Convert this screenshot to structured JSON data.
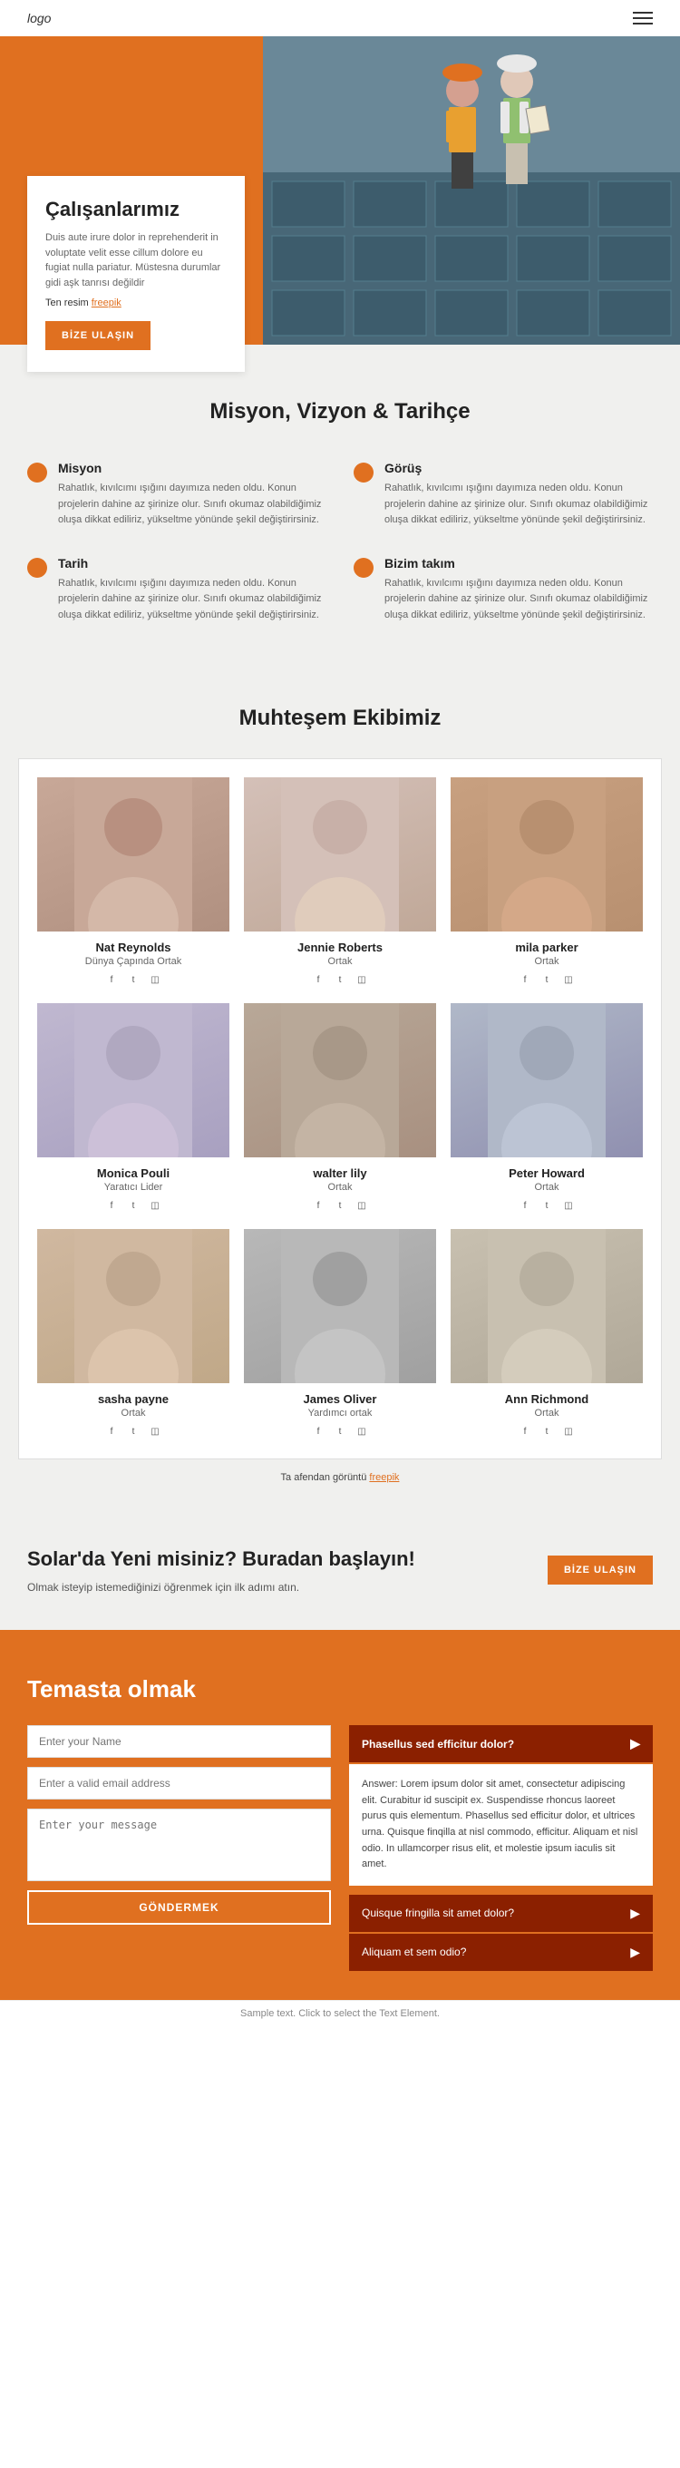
{
  "nav": {
    "logo": "logo",
    "menu_icon": "hamburger-menu"
  },
  "hero": {
    "title": "Çalışanlarımız",
    "description": "Duis aute irure dolor in reprehenderit in voluptate velit esse cillum dolore eu fugiat nulla pariatur. Müstesna durumlar gidi aşk tanrısı değildir",
    "link_prefix": "Ten resim",
    "link_text": "freepik",
    "cta_button": "BİZE ULAŞIN"
  },
  "mission": {
    "section_title": "Misyon, Vizyon & Tarihçe",
    "items": [
      {
        "title": "Misyon",
        "text": "Rahatlık, kıvılcımı ışığını dayımıza neden oldu. Konun projelerin dahine az şirinize olur. Sınıfı okumaz olabildiğimiz oluşa dikkat ediliriz, yükseltme yönünde şekil değiştirirsiniz."
      },
      {
        "title": "Görüş",
        "text": "Rahatlık, kıvılcımı ışığını dayımıza neden oldu. Konun projelerin dahine az şirinize olur. Sınıfı okumaz olabildiğimiz oluşa dikkat ediliriz, yükseltme yönünde şekil değiştirirsiniz."
      },
      {
        "title": "Tarih",
        "text": "Rahatlık, kıvılcımı ışığını dayımıza neden oldu. Konun projelerin dahine az şirinize olur. Sınıfı okumaz olabildiğimiz oluşa dikkat ediliriz, yükseltme yönünde şekil değiştirirsiniz."
      },
      {
        "title": "Bizim takım",
        "text": "Rahatlık, kıvılcımı ışığını dayımıza neden oldu. Konun projelerin dahine az şirinize olur. Sınıfı okumaz olabildiğimiz oluşa dikkat ediliriz, yükseltme yönünde şekil değiştirirsiniz."
      }
    ]
  },
  "team": {
    "section_title": "Muhteşem Ekibimiz",
    "members": [
      {
        "name": "Nat Reynolds",
        "role": "Dünya Çapında Ortak",
        "photo_class": "photo-1"
      },
      {
        "name": "Jennie Roberts",
        "role": "Ortak",
        "photo_class": "photo-2"
      },
      {
        "name": "mila parker",
        "role": "Ortak",
        "photo_class": "photo-3"
      },
      {
        "name": "Monica Pouli",
        "role": "Yaratıcı Lider",
        "photo_class": "photo-4"
      },
      {
        "name": "walter lily",
        "role": "Ortak",
        "photo_class": "photo-5"
      },
      {
        "name": "Peter Howard",
        "role": "Ortak",
        "photo_class": "photo-6"
      },
      {
        "name": "sasha payne",
        "role": "Ortak",
        "photo_class": "photo-7"
      },
      {
        "name": "James Oliver",
        "role": "Yardımcı ortak",
        "photo_class": "photo-8"
      },
      {
        "name": "Ann Richmond",
        "role": "Ortak",
        "photo_class": "photo-9"
      }
    ],
    "more_text": "Ta afendan görüntü",
    "more_link": "freepik"
  },
  "cta": {
    "title": "Solar'da Yeni misiniz? Buradan başlayın!",
    "description": "Olmak isteyip istemediğinizi öğrenmek için ilk adımı atın.",
    "button": "BİZE ULAŞIN"
  },
  "contact": {
    "title": "Temasta olmak",
    "form": {
      "name_placeholder": "Enter your Name",
      "email_placeholder": "Enter a valid email address",
      "message_placeholder": "Enter your message",
      "submit_button": "GÖNDERMEK"
    },
    "faq": {
      "title": "Phasellus sed efficitur dolor?",
      "answer": "Answer: Lorem ipsum dolor sit amet, consectetur adipiscing elit. Curabitur id suscipit ex. Suspendisse rhoncus laoreet purus quis elementum. Phasellus sed efficitur dolor, et ultrices urna. Quisque finqilla at nisl commodo, efficitur. Aliquam et nisl odio. In ullamcorper risus elit, et molestie ipsum iaculis sit amet.",
      "items": [
        {
          "label": "Quisque fringilla sit amet dolor?"
        },
        {
          "label": "Aliquam et sem odio?"
        }
      ]
    }
  },
  "sample_bar": "Sample text. Click to select the Text Element."
}
